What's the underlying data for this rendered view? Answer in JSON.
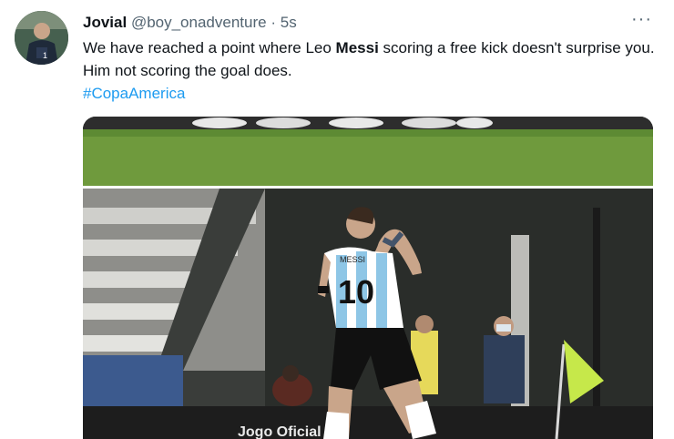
{
  "tweet": {
    "display_name": "Jovial",
    "handle": "@boy_onadventure",
    "separator": "·",
    "timestamp": "5s",
    "text_part1": "We have reached a point where Leo ",
    "text_bold": "Messi",
    "text_part2": " scoring a free kick doesn't surprise you. Him not scoring the goal does.",
    "hashtag": "#CopaAmerica",
    "more_icon": "more-horizontal-icon"
  },
  "media": {
    "jersey_name": "MESSI",
    "jersey_number": "10",
    "board_text": "Jogo Oficial",
    "colors": {
      "grass": "#6f9a3d",
      "shirt_blue": "#8ec6e6",
      "shorts": "#111111",
      "flag": "#c6e84a"
    }
  }
}
